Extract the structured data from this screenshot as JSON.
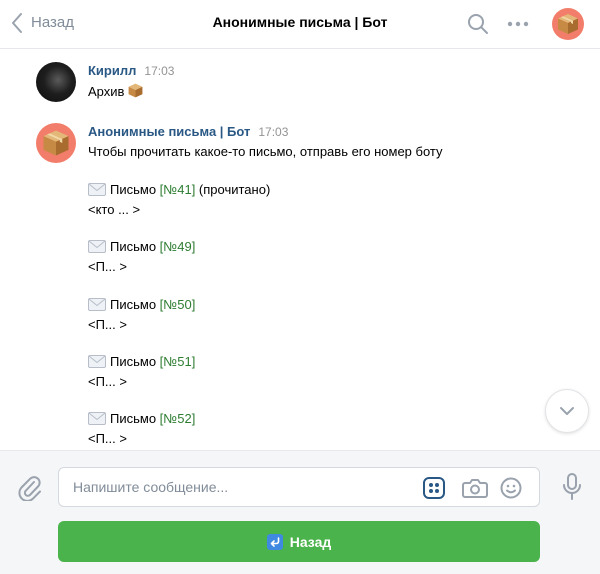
{
  "header": {
    "back_label": "Назад",
    "title": "Анонимные письма | Бот"
  },
  "messages": [
    {
      "author": "Кирилл",
      "time": "17:03",
      "text": "Архив"
    },
    {
      "author": "Анонимные письма | Бот",
      "time": "17:03",
      "text": "Чтобы прочитать какое-то письмо, отправь его номер боту",
      "letters": [
        {
          "prefix": "Письмо ",
          "number": "[№41]",
          "suffix": " (прочитано)",
          "preview": "<кто ... >"
        },
        {
          "prefix": "Письмо ",
          "number": "[№49]",
          "suffix": "",
          "preview": "<П... >"
        },
        {
          "prefix": "Письмо ",
          "number": "[№50]",
          "suffix": "",
          "preview": "<П... >"
        },
        {
          "prefix": "Письмо ",
          "number": "[№51]",
          "suffix": "",
          "preview": "<П... >"
        },
        {
          "prefix": "Письмо ",
          "number": "[№52]",
          "suffix": "",
          "preview": "<П... >"
        }
      ]
    }
  ],
  "composer": {
    "placeholder": "Напишите сообщение..."
  },
  "keyboard": {
    "button_label": "Назад"
  },
  "icons": {
    "back": "chevron-left-icon",
    "search": "search-icon",
    "more": "more-icon",
    "attach": "paperclip-icon",
    "keyboard": "bot-keyboard-icon",
    "camera": "camera-icon",
    "emoji": "smile-icon",
    "mic": "microphone-icon",
    "scroll": "chevron-down-icon",
    "letter": "envelope-icon",
    "box": "package-icon",
    "return": "return-arrow-icon"
  },
  "colors": {
    "accent": "#2a5885",
    "button": "#4bb34b",
    "number": "#2e7d32",
    "muted": "#818c99"
  }
}
